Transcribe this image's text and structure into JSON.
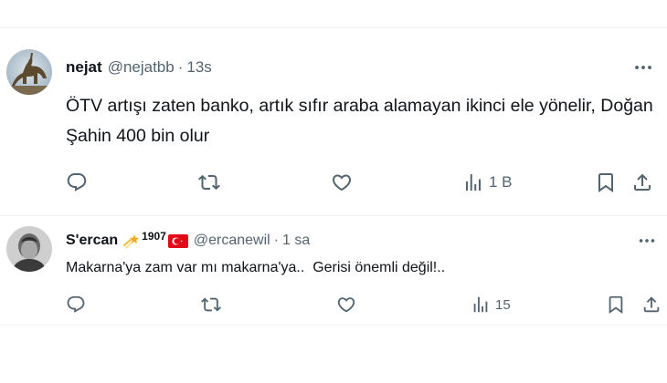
{
  "tweets": [
    {
      "name": "nejat",
      "handle": "@nejatbb",
      "separator": "·",
      "time": "13s",
      "text_line1": "ÖTV artışı zaten banko, artık sıfır araba alamayan ikinci ele yönelir, Doğan",
      "text_line2": "Şahin 400 bin olur",
      "view_count": "1 B",
      "icons": {
        "reply": "reply-icon",
        "retweet": "retweet-icon",
        "like": "heart-icon",
        "views": "views-icon",
        "bookmark": "bookmark-icon",
        "share": "share-icon",
        "more": "more-icon"
      }
    },
    {
      "name": "S'ercan",
      "badge_number": "1907",
      "handle": "@ercanewil",
      "separator": "·",
      "time": "1 sa",
      "text": "Makarna'ya zam var mı makarna'ya..  Gerisi önemli değil!..",
      "view_count": "15",
      "icons": {
        "star": "shooting-star-emoji",
        "flag": "turkey-flag-emoji"
      }
    }
  ],
  "colors": {
    "text": "#0f1419",
    "secondary": "#536471",
    "divider": "#eff3f4",
    "flag_red": "#e30a17"
  }
}
